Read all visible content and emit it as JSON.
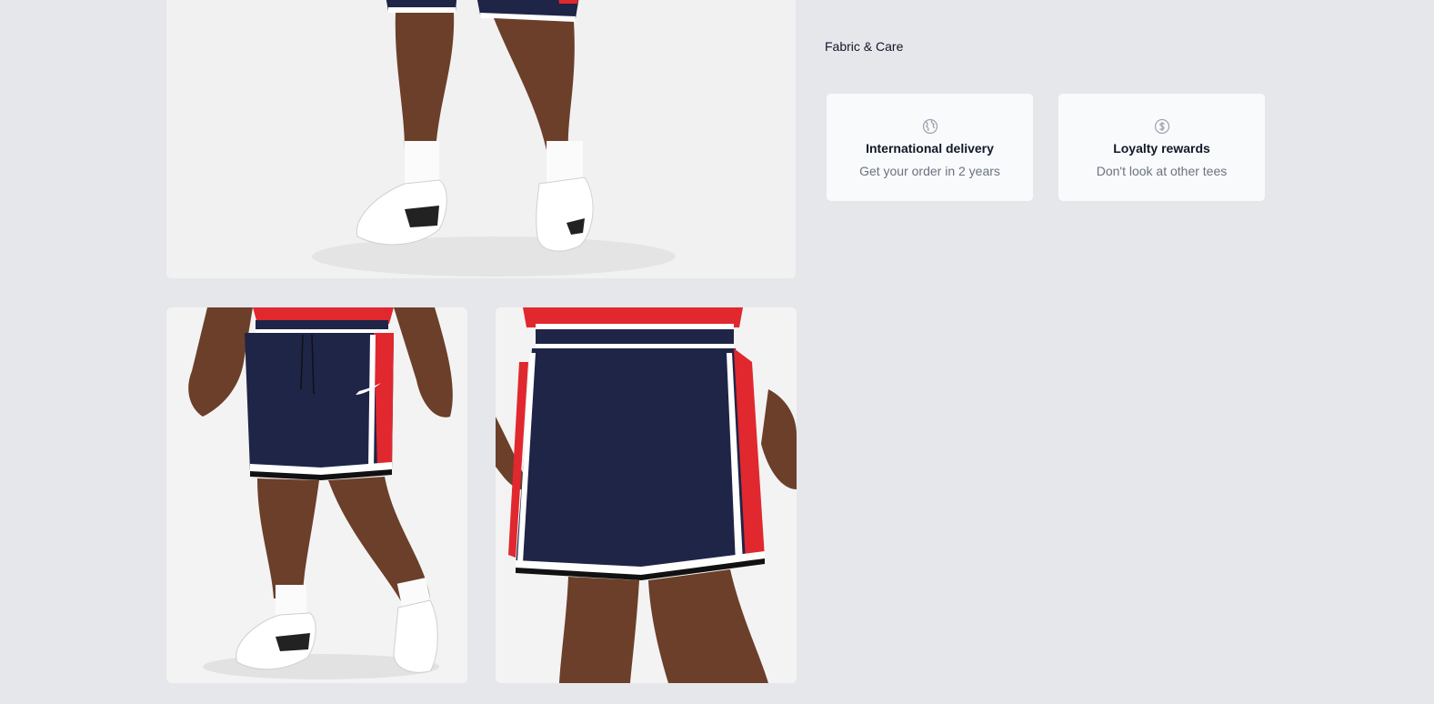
{
  "gallery": {
    "images": [
      {
        "alt": "Model wearing navy and red basketball shorts, lower legs and white sneakers"
      },
      {
        "alt": "Front view of navy basketball shorts with red side panel"
      },
      {
        "alt": "Back view of navy basketball shorts with red side panel"
      }
    ]
  },
  "details": {
    "section_title": "Fabric & Care"
  },
  "perks": [
    {
      "icon": "globe-icon",
      "title": "International delivery",
      "description": "Get your order in 2 years"
    },
    {
      "icon": "currency-dollar-icon",
      "title": "Loyalty rewards",
      "description": "Don't look at other tees"
    }
  ],
  "colors": {
    "background": "#e5e7eb",
    "card": "#f9fafb",
    "navy": "#1e2547",
    "red": "#e0282e",
    "skin": "#6b3f2a"
  }
}
